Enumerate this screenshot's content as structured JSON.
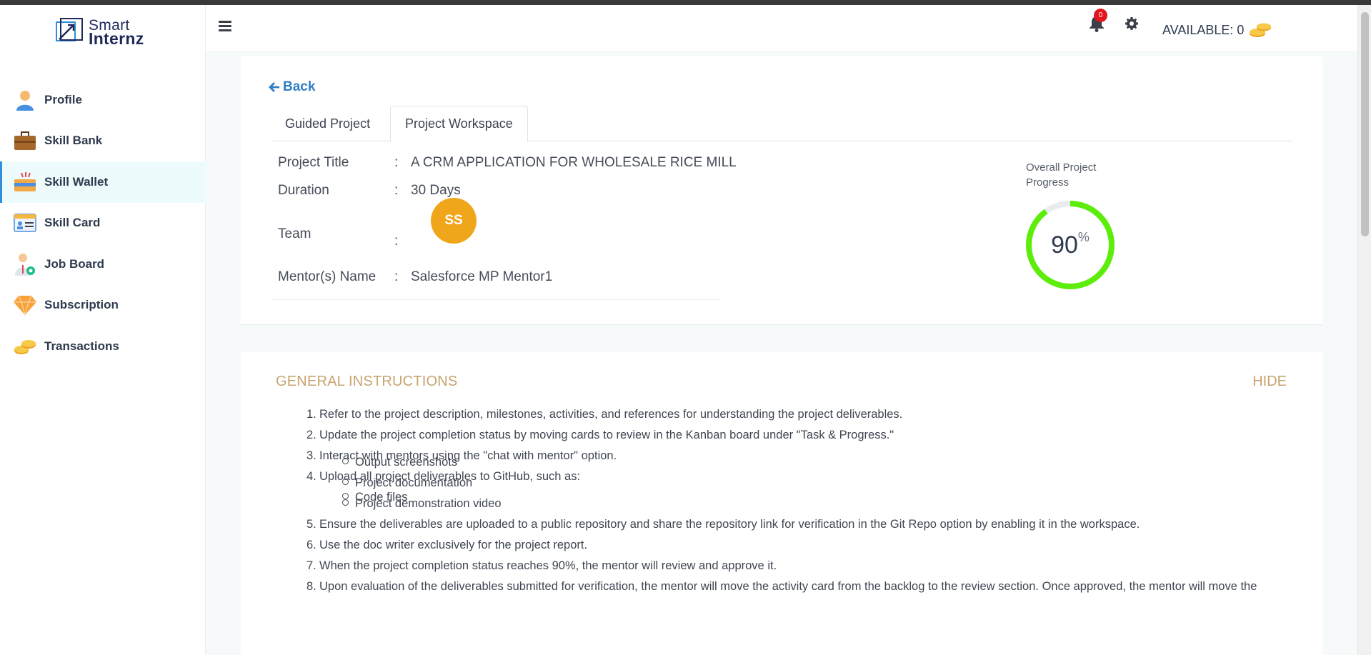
{
  "brand": {
    "name_line1": "Smart",
    "name_line2": "Internz"
  },
  "sidebar": {
    "items": [
      {
        "label": "Profile",
        "icon": "profile-icon"
      },
      {
        "label": "Skill Bank",
        "icon": "briefcase-icon"
      },
      {
        "label": "Skill Wallet",
        "icon": "wallet-icon",
        "active": true
      },
      {
        "label": "Skill Card",
        "icon": "id-card-icon"
      },
      {
        "label": "Job Board",
        "icon": "job-board-icon"
      },
      {
        "label": "Subscription",
        "icon": "diamond-icon"
      },
      {
        "label": "Transactions",
        "icon": "coins-icon"
      }
    ]
  },
  "header": {
    "available_label": "AVAILABLE: 0",
    "notification_count": "0"
  },
  "workspace": {
    "back_label": "Back",
    "tabs": [
      {
        "label": "Guided Project"
      },
      {
        "label": "Project Workspace",
        "active": true
      }
    ],
    "project": {
      "title_label": "Project Title",
      "title_value": "A CRM APPLICATION FOR WHOLESALE RICE MILL",
      "duration_label": "Duration",
      "duration_value": "30 Days",
      "team_label": "Team",
      "team_avatar": "SS",
      "mentor_label": "Mentor(s) Name",
      "mentor_value": "Salesforce MP Mentor1",
      "separator": ":"
    },
    "progress": {
      "label": "Overall Project Progress",
      "value": "90",
      "unit": "%",
      "fraction": 0.9,
      "color": "#5ced0a",
      "track_color": "#e9ecef"
    }
  },
  "instructions": {
    "title": "GENERAL INSTRUCTIONS",
    "hide_label": "HIDE",
    "items": [
      "Refer to the project description, milestones, activities, and references for understanding the project deliverables.",
      "Update the project completion status by moving cards to review in the Kanban board under \"Task & Progress.\"",
      "Interact with mentors using the \"chat with mentor\" option.",
      "Upload all project deliverables to GitHub, such as:",
      "Ensure the deliverables are uploaded to a public repository and share the repository link for verification in the Git Repo option by enabling it in the workspace.",
      "Use the doc writer exclusively for the project report.",
      "When the project completion status reaches 90%, the mentor will review and approve it.",
      "Upon evaluation of the deliverables submitted for verification, the mentor will move the activity card from the backlog to the review section. Once approved, the mentor will move the"
    ],
    "sub_items": [
      "Code files",
      "Output screenshots",
      "Project documentation",
      "Project demonstration video"
    ]
  }
}
